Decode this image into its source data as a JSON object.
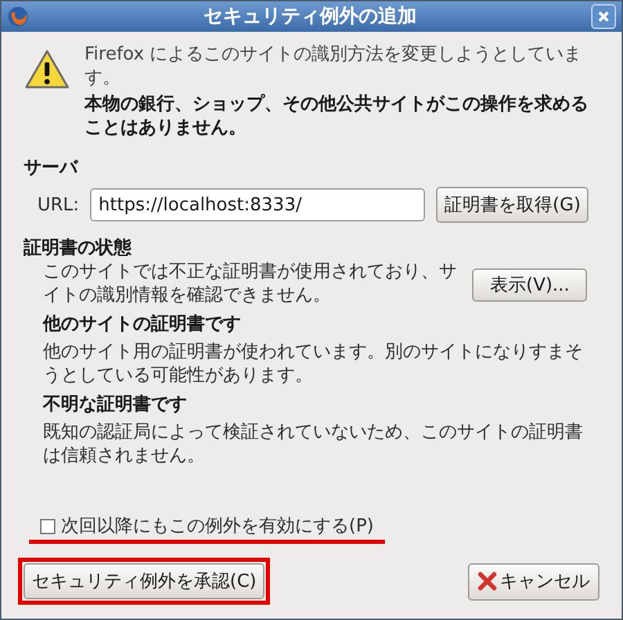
{
  "window": {
    "title": "セキュリティ例外の追加"
  },
  "warning": {
    "line": "Firefox によるこのサイトの識別方法を変更しようとしています。",
    "bold": "本物の銀行、ショップ、その他公共サイトがこの操作を求めることはありません。"
  },
  "server": {
    "heading": "サーバ",
    "url_label": "URL:",
    "url_value": "https://localhost:8333/",
    "get_button": "証明書を取得(G)"
  },
  "status": {
    "heading": "証明書の状態",
    "summary": "このサイトでは不正な証明書が使用されており、サイトの識別情報を確認できません。",
    "view_button": "表示(V)...",
    "issues": [
      {
        "title": "他のサイトの証明書です",
        "detail": "他のサイト用の証明書が使われています。別のサイトになりすまそうとしている可能性があります。"
      },
      {
        "title": "不明な証明書です",
        "detail": "既知の認証局によって検証されていないため、このサイトの証明書は信頼されません。"
      }
    ]
  },
  "permanent": {
    "label": "次回以降にもこの例外を有効にする(P)",
    "checked": false
  },
  "buttons": {
    "confirm": "セキュリティ例外を承認(C)",
    "cancel": "キャンセル"
  }
}
